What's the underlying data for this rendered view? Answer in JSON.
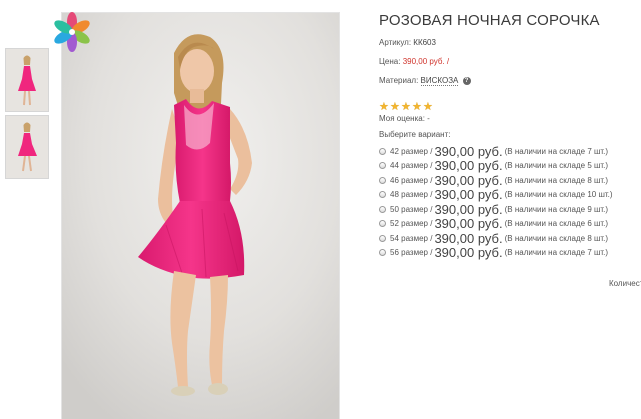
{
  "product": {
    "title": "РОЗОВАЯ НОЧНАЯ СОРОЧКА",
    "sku_label": "Артикул:",
    "sku_value": "КК603",
    "price_label": "Цена:",
    "price_value": "390,00 руб.",
    "price_sep": "/",
    "material_label": "Материал:",
    "material_value": "ВИСКОЗА",
    "help_glyph": "?",
    "rating_stars": 5,
    "my_rating_label": "Моя оценка: -",
    "choose_variant_label": "Выберите вариант:",
    "quantity_label": "Количество"
  },
  "variants": [
    {
      "size": "42 размер /",
      "price": "390,00 руб.",
      "stock": "(В наличии на складе 7 шт.)"
    },
    {
      "size": "44 размер /",
      "price": "390,00 руб.",
      "stock": "(В наличии на складе 5 шт.)"
    },
    {
      "size": "46 размер /",
      "price": "390,00 руб.",
      "stock": "(В наличии на складе 8 шт.)"
    },
    {
      "size": "48 размер /",
      "price": "390,00 руб.",
      "stock": "(В наличии на складе 10 шт.)"
    },
    {
      "size": "50 размер /",
      "price": "390,00 руб.",
      "stock": "(В наличии на складе 9 шт.)"
    },
    {
      "size": "52 размер /",
      "price": "390,00 руб.",
      "stock": "(В наличии на складе 6 шт.)"
    },
    {
      "size": "54 размер /",
      "price": "390,00 руб.",
      "stock": "(В наличии на складе 8 шт.)"
    },
    {
      "size": "56 размер /",
      "price": "390,00 руб.",
      "stock": "(В наличии на складе 7 шт.)"
    }
  ],
  "colors": {
    "dress": "#f0267e",
    "price_accent": "#d0342c",
    "star": "#f3b52f"
  }
}
